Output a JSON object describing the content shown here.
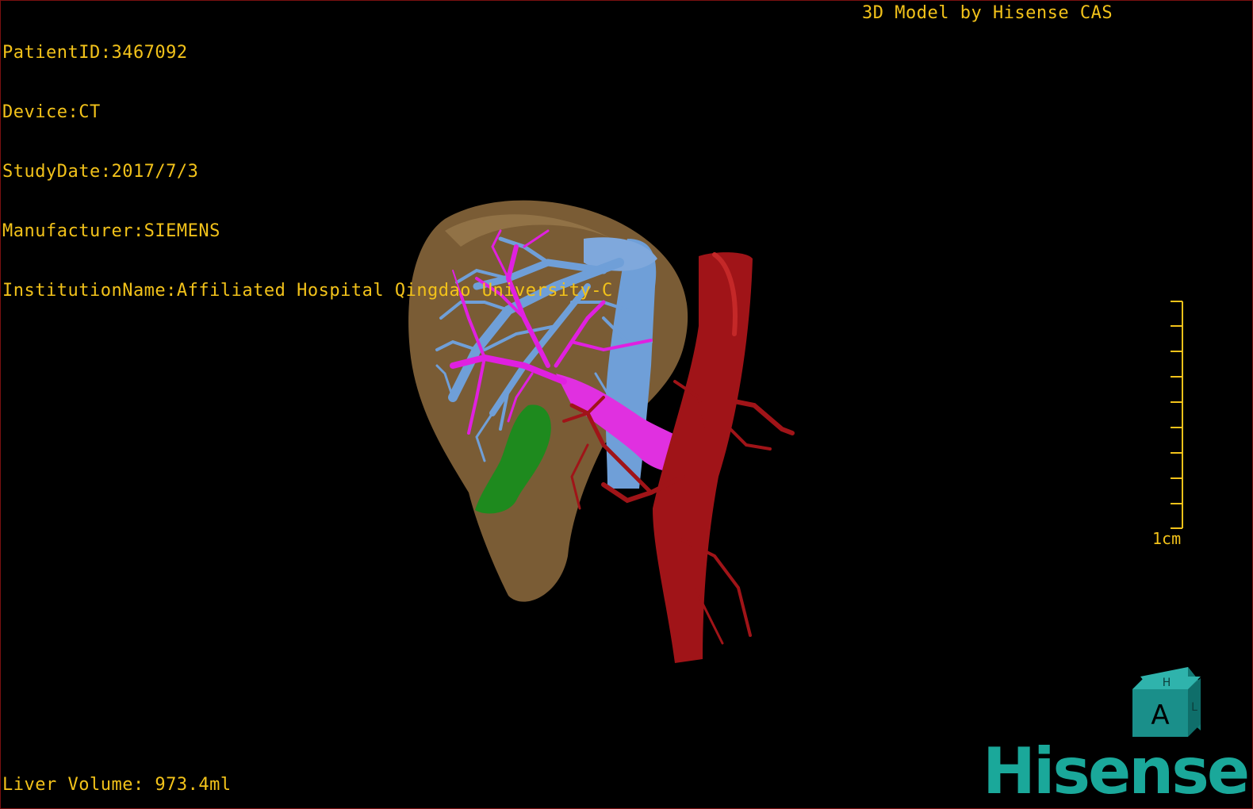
{
  "overlay": {
    "patient_id": "PatientID:3467092",
    "device": "Device:CT",
    "study_date": "StudyDate:2017/7/3",
    "manufacturer": "Manufacturer:SIEMENS",
    "institution": "InstitutionName:Affiliated Hospital Qingdao University-C",
    "model_credit": "3D Model by Hisense CAS",
    "liver_volume": "Liver Volume: 973.4ml"
  },
  "scale_bar": {
    "label": "1cm",
    "color": "#f2c21a"
  },
  "orientation_cube": {
    "front_label": "A",
    "top_label": "H",
    "side_label": "L",
    "color": "#1a8f8a"
  },
  "logo": {
    "text": "Hisense",
    "color": "#1aa89a"
  },
  "model_colors": {
    "liver": "#8a6a3e",
    "hepatic_vein": "#6f9fd8",
    "portal_vein": "#e020e0",
    "artery": "#a01418",
    "gallbladder": "#1e8a1e"
  }
}
